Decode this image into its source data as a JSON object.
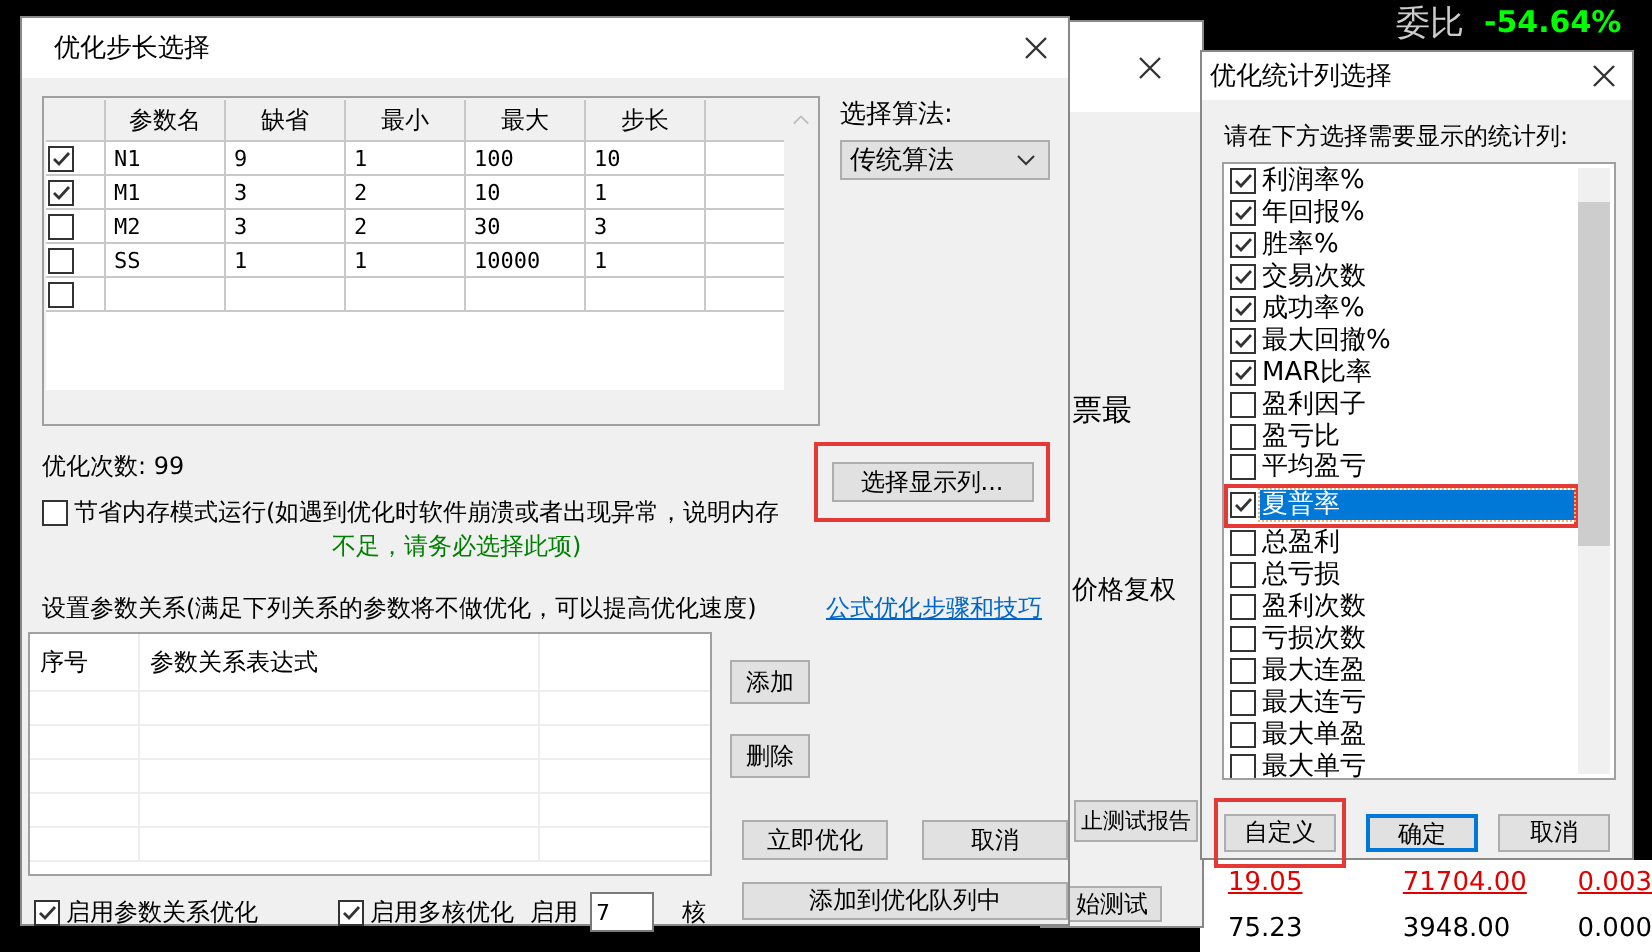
{
  "background": {
    "ratio_label": "委比",
    "ratio_value": "-54.64%",
    "rows": [
      {
        "color": "#e00000",
        "cells": [
          "19.05",
          "71704.00",
          "0.003"
        ]
      },
      {
        "color": "#000000",
        "cells": [
          "75.23",
          "3948.00",
          "0.000"
        ]
      }
    ]
  },
  "back_dialog": {
    "text_1": "票最",
    "text_2": "价格复权",
    "button_1": "止测试报告",
    "button_2": "始测试"
  },
  "main_dialog": {
    "title": "优化步长选择",
    "grid": {
      "columns": [
        "参数名",
        "缺省",
        "最小",
        "最大",
        "步长"
      ],
      "rows": [
        {
          "checked": true,
          "cells": [
            "N1",
            "9",
            "1",
            "100",
            "10"
          ]
        },
        {
          "checked": true,
          "cells": [
            "M1",
            "3",
            "2",
            "10",
            "1"
          ]
        },
        {
          "checked": false,
          "cells": [
            "M2",
            "3",
            "2",
            "30",
            "3"
          ]
        },
        {
          "checked": false,
          "cells": [
            "SS",
            "1",
            "1",
            "10000",
            "1"
          ]
        },
        {
          "checked": false
        }
      ]
    },
    "algorithm_label": "选择算法:",
    "algorithm_value": "传统算法",
    "count_text": "优化次数: 99",
    "select_columns_button": "选择显示列...",
    "memory_mode": {
      "checked": false,
      "label": "节省内存模式运行(如遇到优化时软件崩溃或者出现异常，说明内存",
      "warning": "不足，请务必选择此项)"
    },
    "relations_label": "设置参数关系(满足下列关系的参数将不做优化，可以提高优化速度)",
    "help_link": "公式优化步骤和技巧",
    "relations_table": {
      "columns": [
        "序号",
        "参数关系表达式"
      ]
    },
    "add_button": "添加",
    "delete_button": "删除",
    "optimize_button": "立即优化",
    "cancel_button": "取消",
    "queue_button": "添加到优化队列中",
    "enable_relations": {
      "checked": true,
      "label": "启用参数关系优化"
    },
    "enable_multicore": {
      "checked": true,
      "label": "启用多核优化"
    },
    "cores_label": "启用",
    "cores_value": "7",
    "cores_unit": "核"
  },
  "stat_dialog": {
    "title": "优化统计列选择",
    "prompt": "请在下方选择需要显示的统计列:",
    "items": [
      {
        "label": "利润率%",
        "checked": true,
        "selected": false
      },
      {
        "label": "年回报%",
        "checked": true,
        "selected": false
      },
      {
        "label": "胜率%",
        "checked": true,
        "selected": false
      },
      {
        "label": "交易次数",
        "checked": true,
        "selected": false
      },
      {
        "label": "成功率%",
        "checked": true,
        "selected": false
      },
      {
        "label": "最大回撤%",
        "checked": true,
        "selected": false
      },
      {
        "label": "MAR比率",
        "checked": true,
        "selected": false
      },
      {
        "label": "盈利因子",
        "checked": false,
        "selected": false
      },
      {
        "label": "盈亏比",
        "checked": false,
        "selected": false
      },
      {
        "label": "平均盈亏",
        "checked": false,
        "selected": false
      },
      {
        "label": "夏普率",
        "checked": true,
        "selected": true
      },
      {
        "label": "总盈利",
        "checked": false,
        "selected": false
      },
      {
        "label": "总亏损",
        "checked": false,
        "selected": false
      },
      {
        "label": "盈利次数",
        "checked": false,
        "selected": false
      },
      {
        "label": "亏损次数",
        "checked": false,
        "selected": false
      },
      {
        "label": "最大连盈",
        "checked": false,
        "selected": false
      },
      {
        "label": "最大连亏",
        "checked": false,
        "selected": false
      },
      {
        "label": "最大单盈",
        "checked": false,
        "selected": false
      },
      {
        "label": "最大单亏",
        "checked": false,
        "selected": false
      }
    ],
    "custom_button": "自定义",
    "ok_button": "确定",
    "cancel_button": "取消"
  }
}
